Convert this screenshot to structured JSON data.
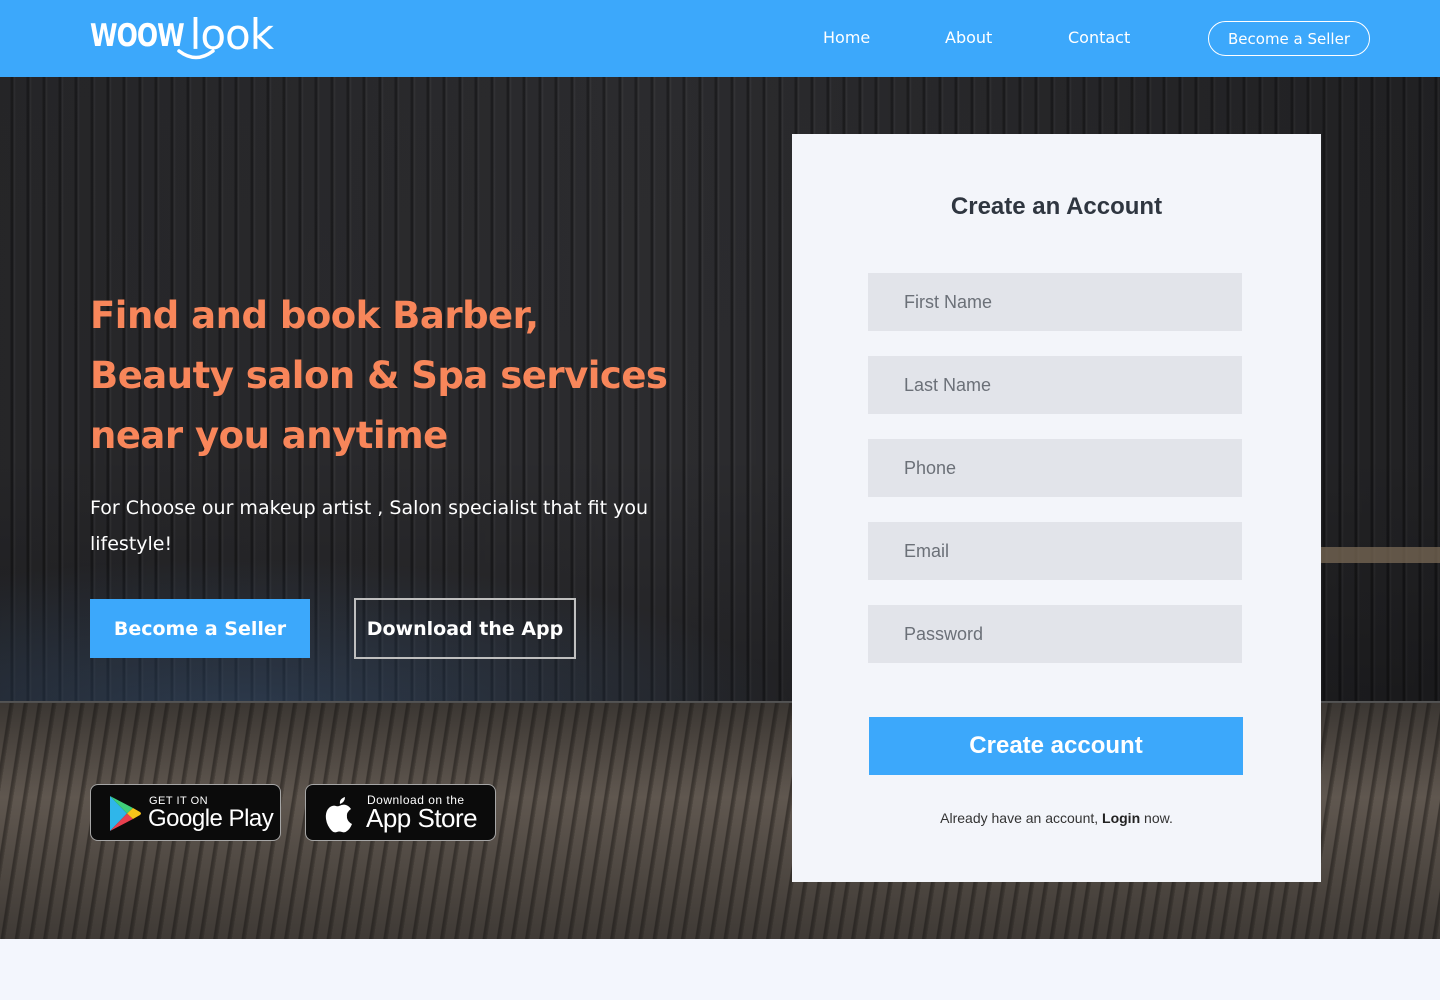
{
  "header": {
    "logo_left": "WOOW",
    "logo_right": "look",
    "nav": {
      "home": "Home",
      "about": "About",
      "contact": "Contact",
      "seller": "Become a Seller"
    }
  },
  "hero": {
    "title": "Find and book Barber, Beauty salon & Spa services near you anytime",
    "subtitle": "For Choose our makeup artist , Salon specialist that fit you lifestyle!",
    "primary_button": "Become a Seller",
    "secondary_button": "Download the App",
    "google_play": {
      "small": "GET IT ON",
      "big": "Google Play",
      "icon": "google-play-icon"
    },
    "app_store": {
      "small": "Download on the",
      "big": "App Store",
      "icon": "apple-icon"
    }
  },
  "signup": {
    "title": "Create an Account",
    "fields": {
      "first_name": "First Name",
      "last_name": "Last Name",
      "phone": "Phone",
      "email": "Email",
      "password": "Password"
    },
    "submit": "Create account",
    "login_prefix": "Already have an account, ",
    "login_link": "Login",
    "login_suffix": " now."
  },
  "colors": {
    "accent": "#3ca8fb",
    "headline": "#f8865a",
    "card_bg": "#f3f5fa",
    "field_bg": "#e2e4ea"
  }
}
